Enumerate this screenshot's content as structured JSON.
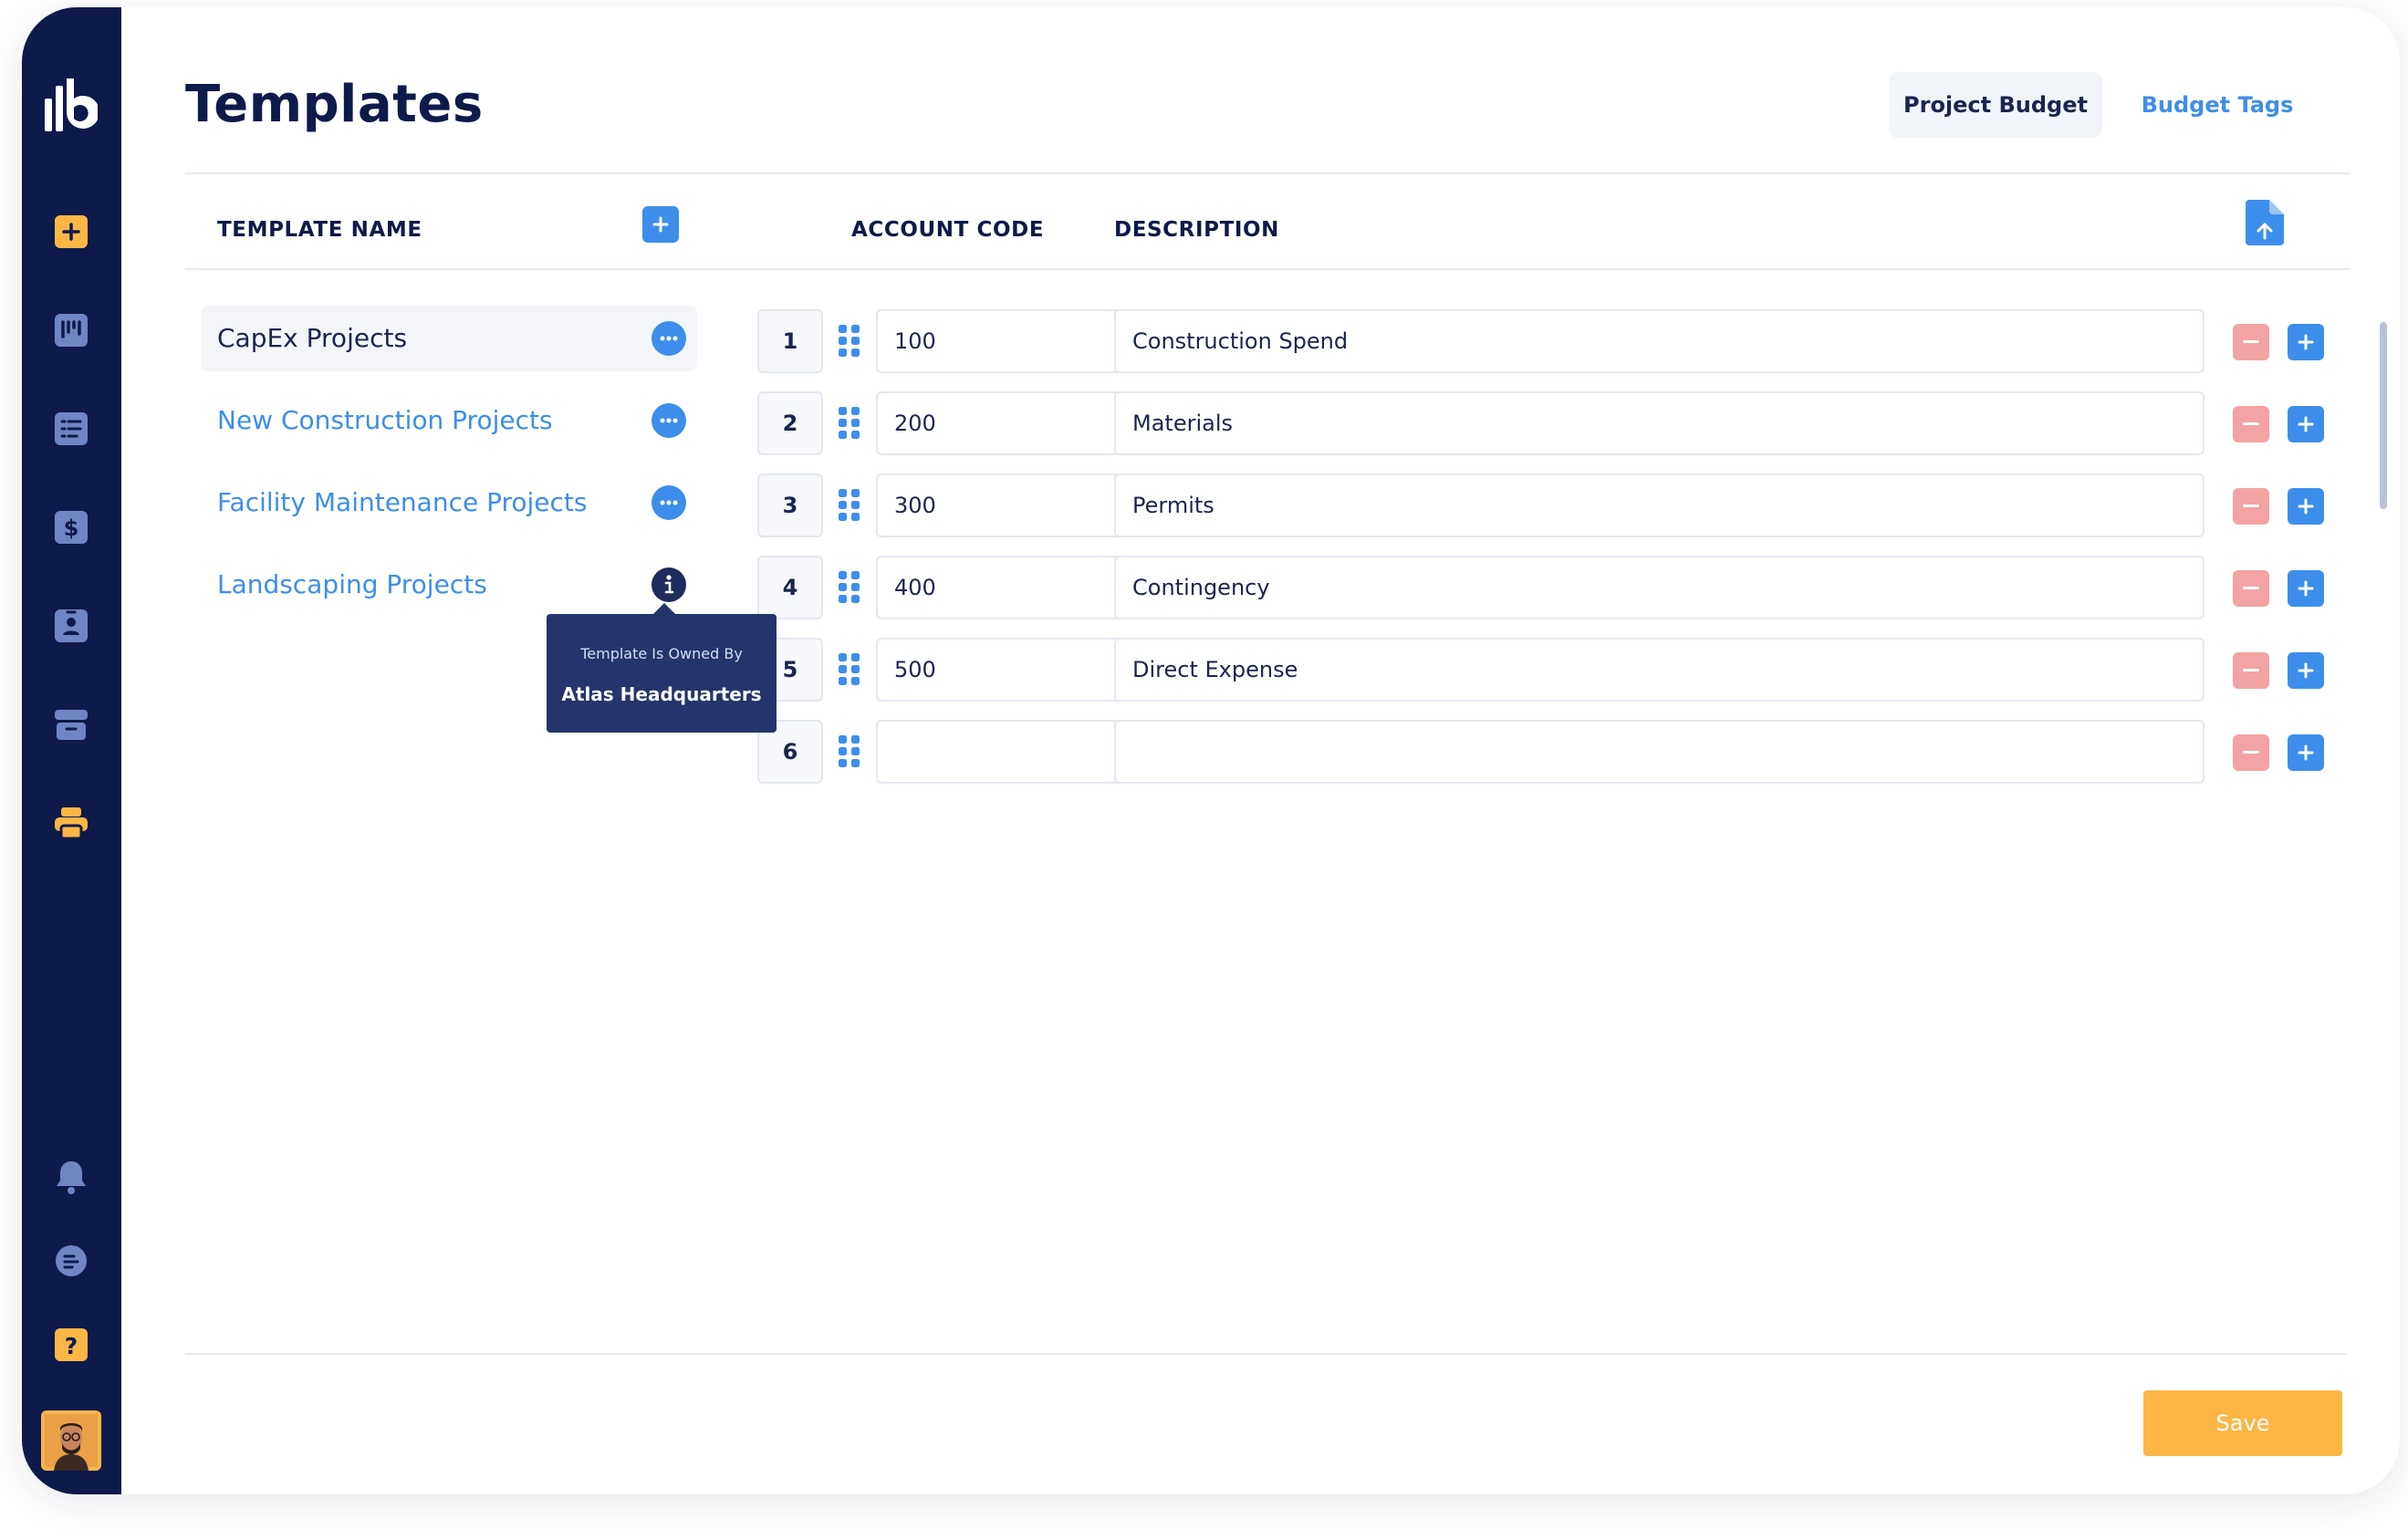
{
  "page": {
    "title": "Templates"
  },
  "tabs": [
    {
      "label": "Project Budget",
      "active": true
    },
    {
      "label": "Budget Tags",
      "active": false
    }
  ],
  "columns": {
    "template_name": "TEMPLATE NAME",
    "account_code": "ACCOUNT CODE",
    "description": "DESCRIPTION"
  },
  "templates": [
    {
      "name": "CapEx Projects",
      "active": true,
      "action": "more"
    },
    {
      "name": "New Construction Projects",
      "active": false,
      "action": "more"
    },
    {
      "name": "Facility Maintenance Projects",
      "active": false,
      "action": "more"
    },
    {
      "name": "Landscaping Projects",
      "active": false,
      "action": "info"
    }
  ],
  "tooltip": {
    "line1": "Template Is Owned By",
    "line2": "Atlas Headquarters"
  },
  "rows": [
    {
      "num": "1",
      "code": "100",
      "description": "Construction Spend"
    },
    {
      "num": "2",
      "code": "200",
      "description": "Materials"
    },
    {
      "num": "3",
      "code": "300",
      "description": "Permits"
    },
    {
      "num": "4",
      "code": "400",
      "description": "Contingency"
    },
    {
      "num": "5",
      "code": "500",
      "description": "Direct Expense"
    },
    {
      "num": "6",
      "code": "",
      "description": ""
    }
  ],
  "save_label": "Save",
  "colors": {
    "sidebar": "#0e1a4a",
    "accent_blue": "#3d8eea",
    "accent_yellow": "#fbb646",
    "remove_red": "#f3a3a3",
    "sidebar_icon": "#6f86c4"
  },
  "sidebar_icons": [
    "logo-icon",
    "add-icon",
    "board-icon",
    "list-icon",
    "dollar-icon",
    "contacts-icon",
    "archive-icon",
    "printer-icon",
    "bell-icon",
    "chat-icon",
    "help-icon",
    "avatar"
  ]
}
